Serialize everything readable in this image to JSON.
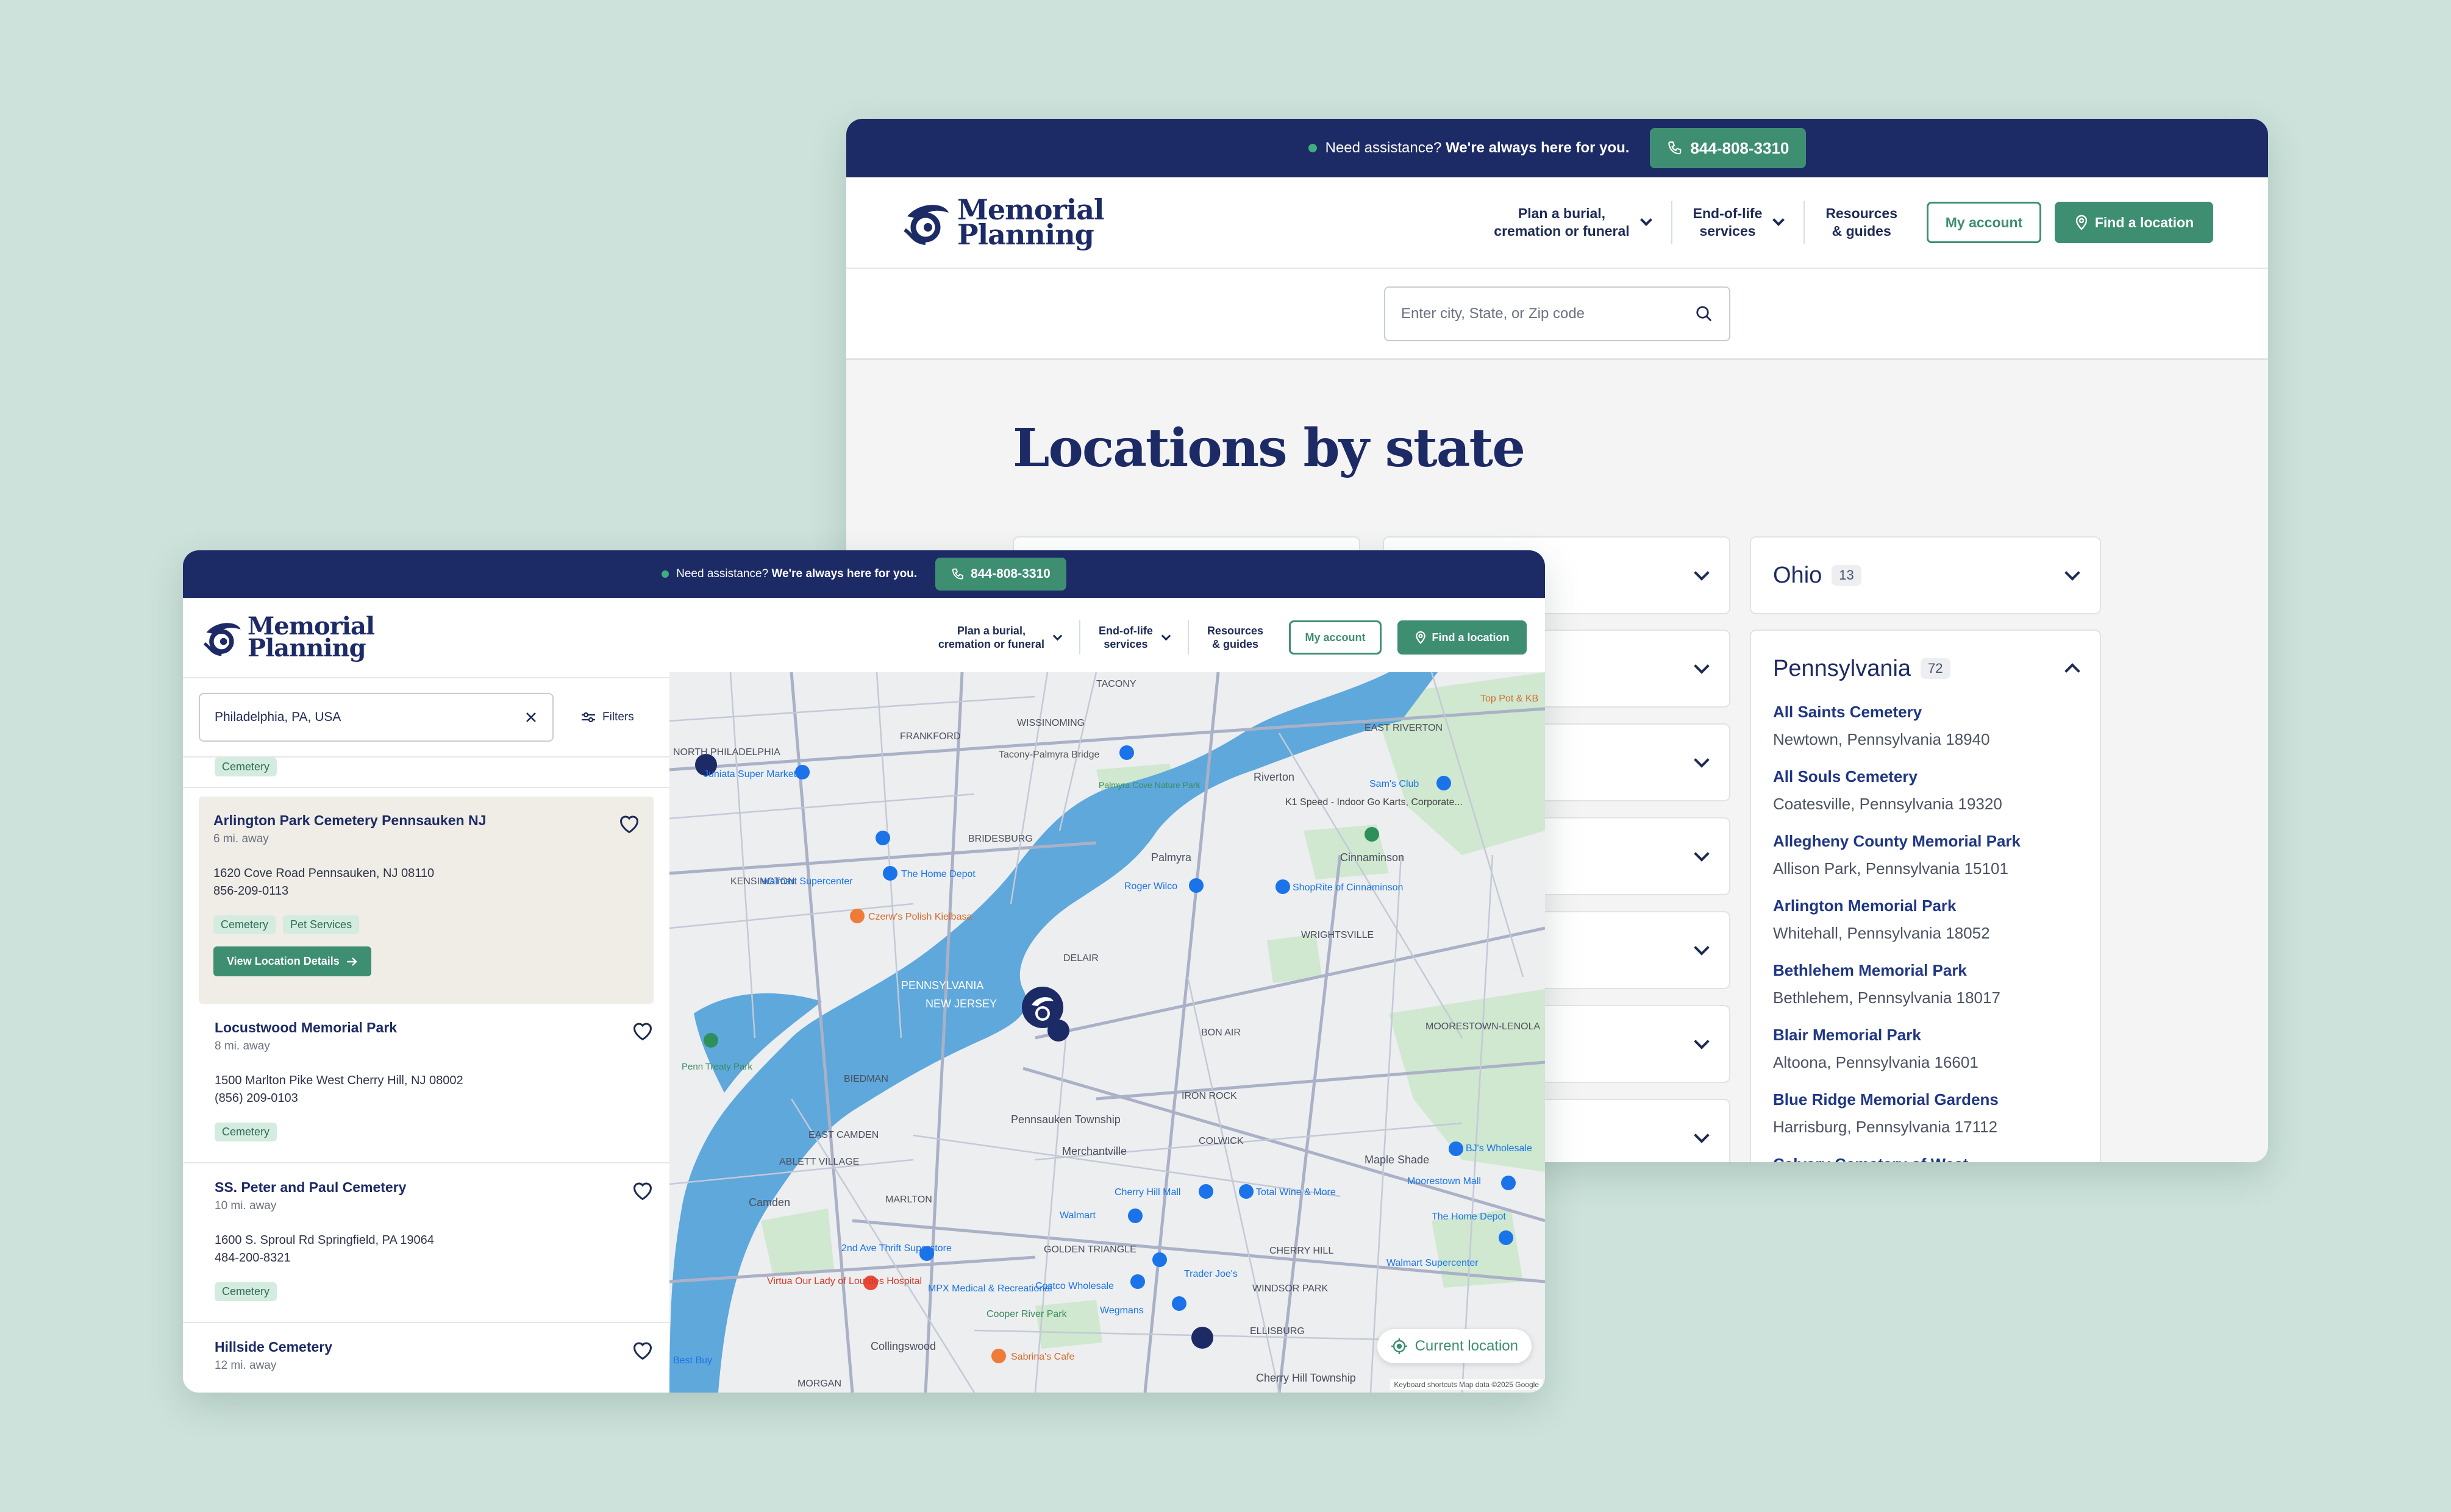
{
  "assist_prefix": "Need assistance?",
  "assist_strong": "We're always here for you.",
  "phone": "844-808-3310",
  "logo_line1": "Memorial",
  "logo_line2": "Planning",
  "nav": {
    "plan_l1": "Plan a burial,",
    "plan_l2": "cremation or funeral",
    "eol_l1": "End-of-life",
    "eol_l2": "services",
    "res_l1": "Resources",
    "res_l2": "& guides",
    "my_account": "My account",
    "find_location": "Find a location"
  },
  "back": {
    "search_placeholder": "Enter city, State, or Zip code",
    "title": "Locations by state",
    "ohio": {
      "name": "Ohio",
      "count": "13"
    },
    "pennsylvania": {
      "name": "Pennsylvania",
      "count": "72"
    },
    "locations": [
      {
        "name": "All Saints Cemetery",
        "addr": "Newtown, Pennsylvania 18940"
      },
      {
        "name": "All Souls Cemetery",
        "addr": "Coatesville, Pennsylvania 19320"
      },
      {
        "name": "Allegheny County Memorial Park",
        "addr": "Allison Park, Pennsylvania 15101"
      },
      {
        "name": "Arlington Memorial Park",
        "addr": "Whitehall, Pennsylvania 18052"
      },
      {
        "name": "Bethlehem Memorial Park",
        "addr": "Bethlehem, Pennsylvania 18017"
      },
      {
        "name": "Blair Memorial Park",
        "addr": "Altoona, Pennsylvania 16601"
      },
      {
        "name": "Blue Ridge Memorial Gardens",
        "addr": "Harrisburg, Pennsylvania 17112"
      },
      {
        "name": "Calvary Cemetery of West Conshohocken",
        "addr": ""
      }
    ]
  },
  "front": {
    "search_value": "Philadelphia, PA, USA",
    "filters": "Filters",
    "tag_cemetery": "Cemetery",
    "tag_pet": "Pet Services",
    "view_details": "View Location Details",
    "cards": [
      {
        "name": "Arlington Park Cemetery Pennsauken NJ",
        "dist": "6 mi. away",
        "addr": "1620 Cove Road Pennsauken, NJ 08110",
        "phone": "856-209-0113"
      },
      {
        "name": "Locustwood Memorial Park",
        "dist": "8 mi. away",
        "addr": "1500 Marlton Pike West Cherry Hill, NJ 08002",
        "phone": "(856) 209-0103"
      },
      {
        "name": "SS. Peter and Paul Cemetery",
        "dist": "10 mi. away",
        "addr": "1600 S. Sproul Rd Springfield, PA 19064",
        "phone": "484-200-8321"
      },
      {
        "name": "Hillside Cemetery",
        "dist": "12 mi. away"
      }
    ],
    "current_location": "Current location",
    "map_attribution": "Keyboard shortcuts   Map data ©2025 Google",
    "map_labels": {
      "tacony": "TACONY",
      "east_riverton": "EAST RIVERTON",
      "riverton": "Riverton",
      "frankford": "FRANKFORD",
      "wissinoming": "WISSINOMING",
      "palmyra_cove": "Palmyra Cove Nature Park",
      "bridesburg": "BRIDESBURG",
      "kensington": "KENSINGTON",
      "palmyra": "Palmyra",
      "cinnaminson": "Cinnaminson",
      "delair": "DELAIR",
      "wrightsville": "WRIGHTSVILLE",
      "pennsylvania": "PENNSYLVANIA",
      "new_jersey": "NEW JERSEY",
      "moorestown": "MOORESTOWN-LENOLA",
      "bon_air": "BON AIR",
      "iron_rock": "IRON ROCK",
      "biedman": "BIEDMAN",
      "east_camden": "EAST CAMDEN",
      "pennsauken": "Pennsauken Township",
      "merchantville": "Merchantville",
      "colwick": "COLWICK",
      "maple_shade": "Maple Shade",
      "abllett": "ABLETT VILLAGE",
      "camden": "Camden",
      "marlton": "MARLTON",
      "golden_triangle": "GOLDEN TRIANGLE",
      "cherry_hill": "CHERRY HILL",
      "windsor_park": "WINDSOR PARK",
      "ellisburg": "ELLISBURG",
      "collingswood": "Collingswood",
      "cherry_hill_twp": "Cherry Hill Township",
      "morgan": "MORGAN",
      "penn_treaty": "Penn Treaty Park",
      "north_phila": "NORTH PHILADELPHIA"
    },
    "map_pois": {
      "walmart_super": "Walmart Supercenter",
      "home_depot": "The Home Depot",
      "czerws": "Czerw's Polish Kielbasa",
      "tacony_bridge": "Tacony-Palmyra Bridge",
      "sams_club": "Sam's Club",
      "k1_speed": "K1 Speed - Indoor Go Karts, Corporate...",
      "shoprite": "ShopRite of Cinnaminson",
      "roger_wilco": "Roger Wilco",
      "top_pot": "Top Pot & KB",
      "cherry_hill_mall": "Cherry Hill Mall",
      "total_wine": "Total Wine & More",
      "walmart": "Walmart",
      "moorestown_mall": "Moorestown Mall",
      "home_depot2": "The Home Depot",
      "bjs": "BJ's Wholesale",
      "walmart_super2": "Walmart Supercenter",
      "second_ave": "2nd Ave Thrift Superstore",
      "virtua": "Virtua Our Lady of Lourdes Hospital",
      "mpx": "MPX Medical & Recreational",
      "costco": "Costco Wholesale",
      "trader_joes": "Trader Joe's",
      "wegmans": "Wegmans",
      "cooper": "Cooper River Park",
      "sabrinas": "Sabrina's Cafe",
      "best_buy": "Best Buy",
      "juniata": "Juniata Super Market"
    }
  },
  "colors": {
    "navy": "#1c2a66",
    "green": "#3e8e72",
    "background": "#cce2da",
    "water": "#5ea8dc"
  }
}
